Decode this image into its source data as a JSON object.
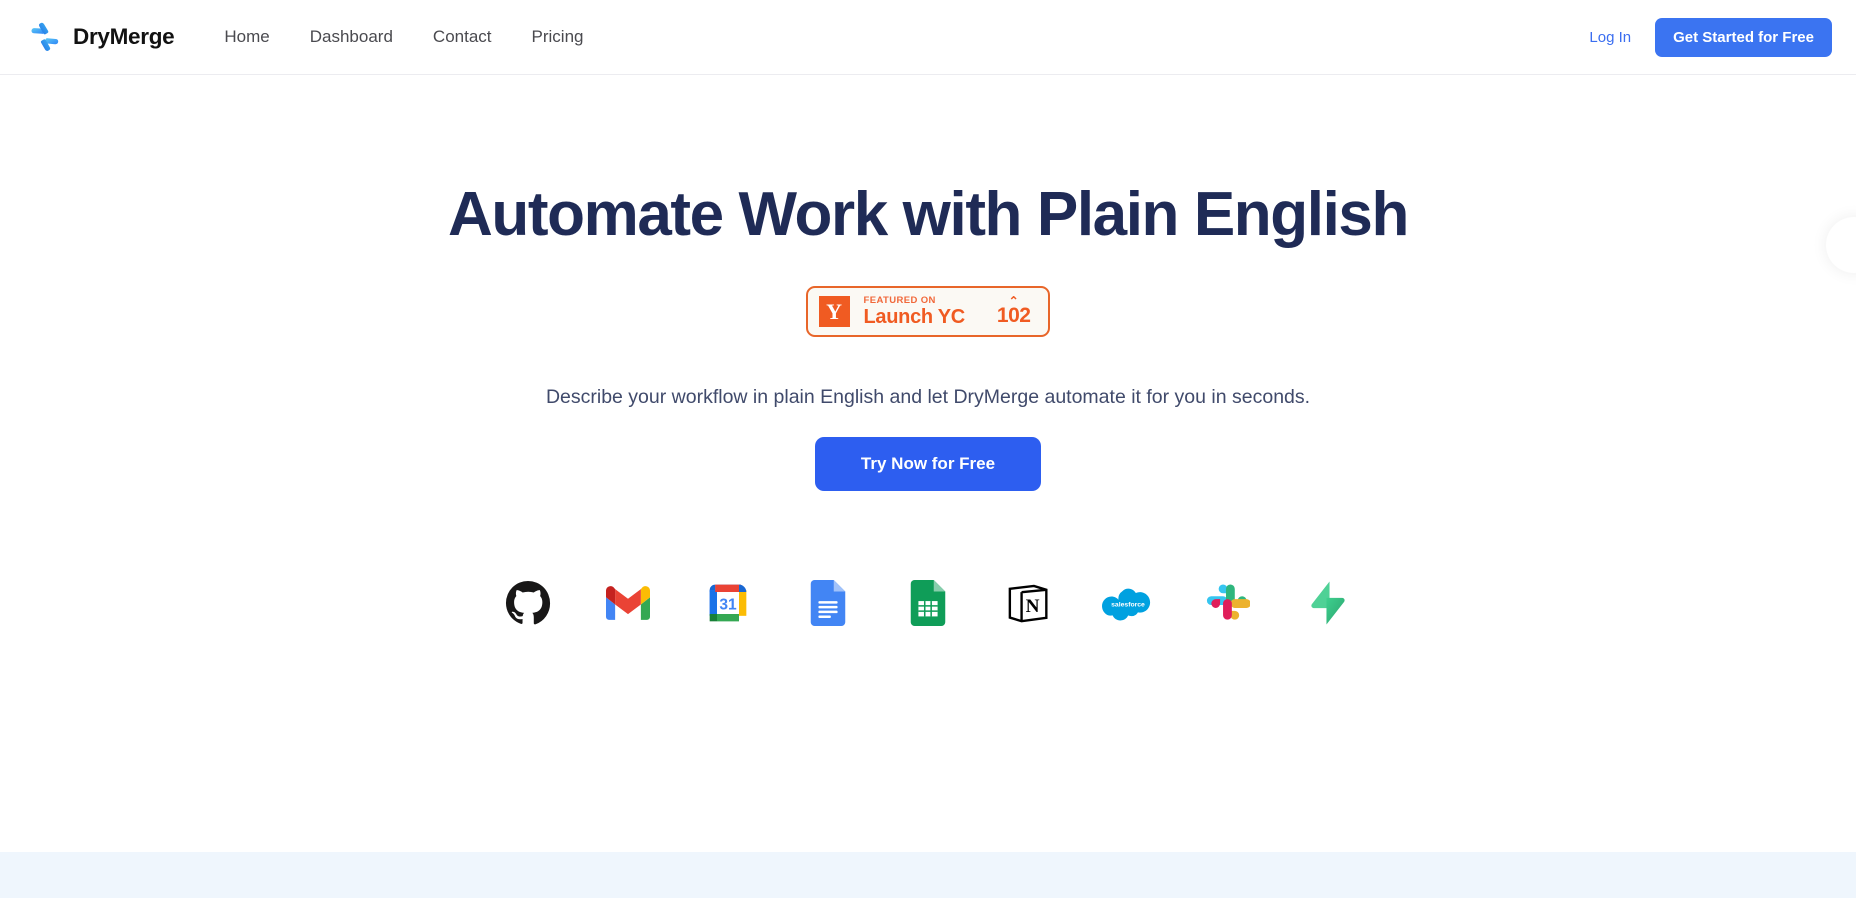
{
  "header": {
    "brand_name": "DryMerge",
    "brand_logo_icon": "drymerge-pinwheel-icon",
    "nav": [
      {
        "label": "Home"
      },
      {
        "label": "Dashboard"
      },
      {
        "label": "Contact"
      },
      {
        "label": "Pricing"
      }
    ],
    "login_label": "Log In",
    "cta_label": "Get Started for Free"
  },
  "hero": {
    "title": "Automate Work with Plain English",
    "subtitle": "Describe your workflow in plain English and let DryMerge automate it for you in seconds.",
    "cta_label": "Try Now for Free",
    "yc_badge": {
      "mark": "Y",
      "kicker": "FEATURED ON",
      "label": "Launch YC",
      "caret": "⌃",
      "votes": "102"
    },
    "integrations": [
      {
        "name": "github-icon"
      },
      {
        "name": "gmail-icon"
      },
      {
        "name": "google-calendar-icon"
      },
      {
        "name": "google-docs-icon"
      },
      {
        "name": "google-sheets-icon"
      },
      {
        "name": "notion-icon"
      },
      {
        "name": "salesforce-icon"
      },
      {
        "name": "slack-icon"
      },
      {
        "name": "supabase-icon"
      }
    ]
  },
  "colors": {
    "brand_blue": "#3b74f1",
    "cta_blue": "#2d5ef0",
    "heading_navy": "#1f2b56",
    "yc_orange": "#f05b22",
    "yc_badge_bg": "#fbf9f4",
    "bottom_band": "#eff6fd"
  }
}
